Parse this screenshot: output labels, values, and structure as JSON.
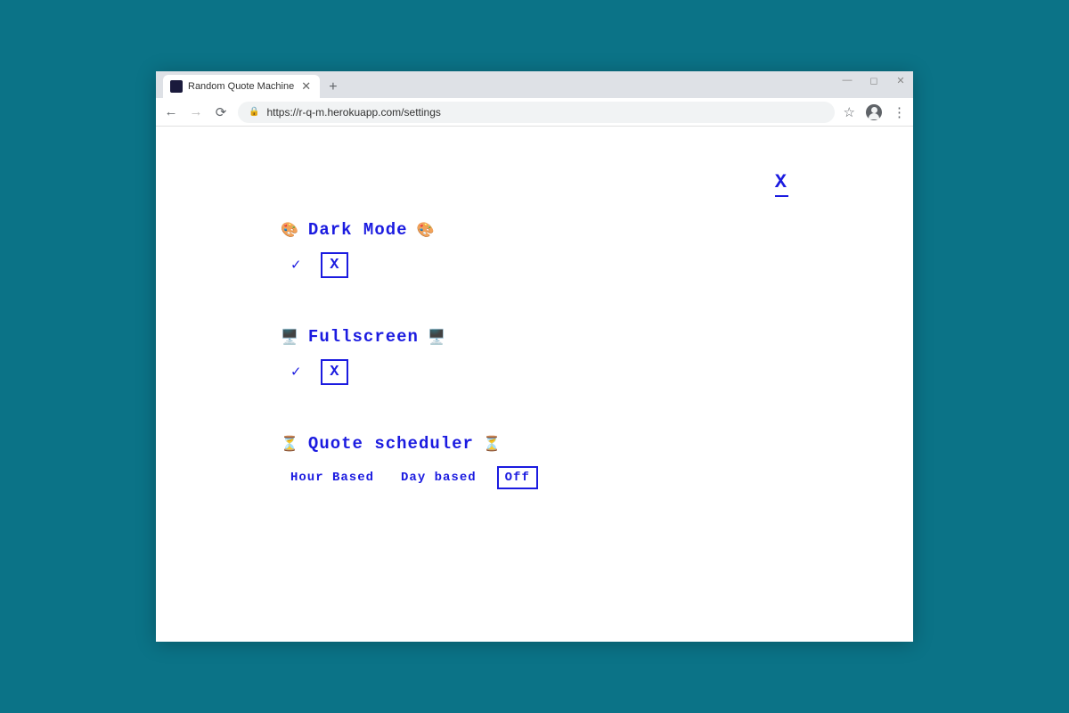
{
  "browser": {
    "tab_title": "Random Quote Machine",
    "url": "https://r-q-m.herokuapp.com/settings"
  },
  "page": {
    "close_label": "X",
    "sections": {
      "dark_mode": {
        "title": "Dark Mode",
        "icon": "🎨",
        "on": "✓",
        "off": "X",
        "selected": "off"
      },
      "fullscreen": {
        "title": "Fullscreen",
        "icon": "🖥️",
        "on": "✓",
        "off": "X",
        "selected": "off"
      },
      "scheduler": {
        "title": "Quote scheduler",
        "icon": "⏳",
        "options": {
          "hour": "Hour Based",
          "day": "Day based",
          "off": "Off"
        },
        "selected": "off"
      }
    }
  }
}
